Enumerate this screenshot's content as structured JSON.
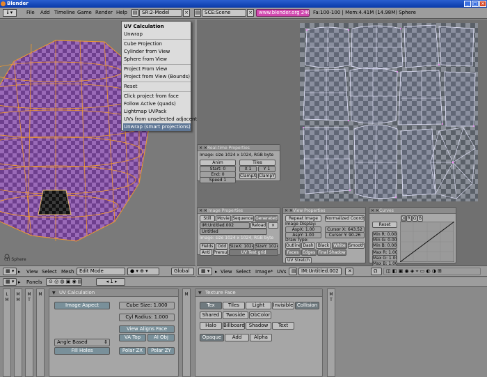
{
  "app": {
    "title": "Blender"
  },
  "menu": {
    "items": [
      "File",
      "Add",
      "Timeline",
      "Game",
      "Render",
      "Help"
    ]
  },
  "header": {
    "screen": "SR:2-Model",
    "scene": "SCE:Scene",
    "url": "www.blender.org 246",
    "stats": "Fa:100-100 | Mem:4.41M (14.98M) Sphere"
  },
  "uv_menu": {
    "title": "UV Calculation",
    "items": [
      "Unwrap",
      "Cube Projection",
      "Cylinder from View",
      "Sphere from View",
      "Project From View",
      "Project from View (Bounds)",
      "Reset",
      "Click project from face",
      "Follow Active (quads)",
      "Lightmap UVPack",
      "UVs from unselected adjacent",
      "Unwrap (smart projections)"
    ],
    "selected_index": 11
  },
  "view3d": {
    "object_label": "(1) Sphere"
  },
  "realtime_panel": {
    "title": "Real-time Properties",
    "image_info": "Image: size 1024 x 1024, RGB byte",
    "anim_label": "Anim",
    "tiles_label": "Tiles",
    "start": "Start: 0",
    "end": "End: 0",
    "speed": "Speed 1",
    "tile_x": "X 1",
    "tile_y": "Y 1",
    "clamp_x": "ClampX",
    "clamp_y": "ClampY"
  },
  "image_panel": {
    "title": "Image Properties",
    "tabs": [
      "Still",
      "Movie",
      "Sequence",
      "Generated"
    ],
    "image_name": "IM:Untitled.002",
    "reload": "Reload",
    "untitled": "Untitled",
    "info": "Image: size 1024 x 1024, RGB byte",
    "fields": "Fields",
    "odd": "Odd",
    "size_x": "SizeX: 1024",
    "size_y": "SizeY: 1024",
    "anti": "Anti",
    "premul": "Premul",
    "uv_test_grid": "UV Test grid"
  },
  "view_panel": {
    "title": "View Properties",
    "repeat_image": "Repeat Image",
    "normalized_coords": "Normalized Coords",
    "image_display": "Image Display:",
    "asp_x": "AspX: 1.00",
    "asp_y": "AspY: 1.00",
    "cursor_x": "Cursor X: 643.52",
    "cursor_y": "Cursor Y: 90.26",
    "draw_type": "Draw Type:",
    "draw_types": [
      "Outline",
      "Dash",
      "Black",
      "White",
      "Smooth"
    ],
    "faces": "Faces",
    "edges": "Edges",
    "final_shadow": "Final Shadow",
    "uv_stretch": "UV Stretch"
  },
  "curves_panel": {
    "title": "Curves",
    "channels": [
      "C",
      "R",
      "G",
      "B"
    ],
    "reset": "Reset",
    "min_r": "Min R: 0.00",
    "min_g": "Min G: 0.00",
    "min_b": "Min B: 0.00",
    "max_r": "Max R: 1.00",
    "max_g": "Max G: 1.00",
    "max_b": "Max B: 1.00"
  },
  "view3d_header": {
    "view": "View",
    "select": "Select",
    "mesh": "Mesh",
    "mode": "Edit Mode",
    "pivot": "Global"
  },
  "uv_header": {
    "view": "View",
    "select": "Select",
    "image": "Image*",
    "uvs": "UVs",
    "image_name": "IM:Untitled.002"
  },
  "buttons_header": {
    "panels": "Panels",
    "frame": "1"
  },
  "tabs_left": [
    "L",
    "M"
  ],
  "uvcalc_panel": {
    "title": "UV Calculation",
    "image_aspect": "Image Aspect",
    "cube_size": "Cube Size: 1.000",
    "cyl_radius": "Cyl Radius: 1.000",
    "view_aligns_face": "View Aligns Face",
    "va_top": "VA Top",
    "al_obj": "Al Obj",
    "angle_based": "Angle Based",
    "fill_holes": "Fill Holes",
    "polar_zx": "Polar ZX",
    "polar_zy": "Polar ZY"
  },
  "texface_panel": {
    "title": "Texture Face",
    "row1": [
      "Tex",
      "Tiles",
      "Light",
      "Invisible",
      "Collision"
    ],
    "row2": [
      "Shared",
      "Twoside",
      "ObColor"
    ],
    "row3": [
      "Halo",
      "Billboard",
      "Shadow",
      "Text"
    ],
    "row4": [
      "Opaque",
      "Add",
      "Alpha"
    ]
  },
  "colors": {
    "wire": "#f09a2a",
    "purple": "#8a5aa8",
    "selected": "#5f7796"
  }
}
